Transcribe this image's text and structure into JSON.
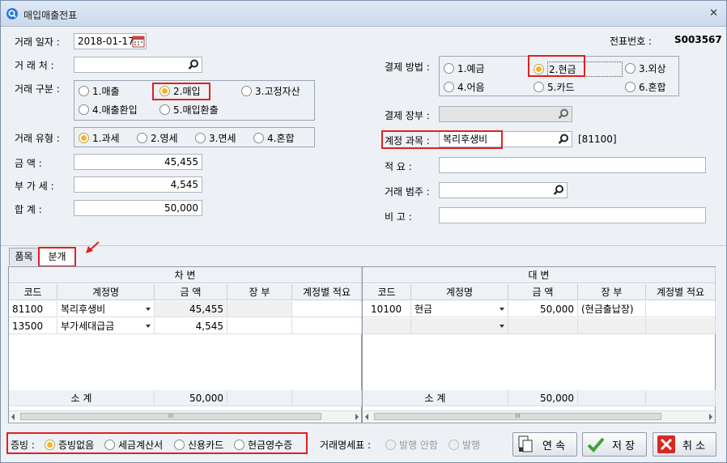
{
  "window": {
    "title": "매입매출전표",
    "close": "✕"
  },
  "header": {
    "date_label": "거래 일자 :",
    "date_value": "2018-01-17",
    "voucher_label": "전표번호 :",
    "voucher_value": "S003567",
    "partner_label": "거 래 처 :",
    "partner_value": "",
    "type_label": "거래 구분 :",
    "type_options": [
      "1.매출",
      "2.매입",
      "3.고정자산",
      "4.매출환입",
      "5.매입환출"
    ],
    "type_selected": "2.매입",
    "kind_label": "거래 유형 :",
    "kind_options": [
      "1.과세",
      "2.영세",
      "3.면세",
      "4.혼합"
    ],
    "kind_selected": "1.과세",
    "amount_label": "금     액 :",
    "amount_value": "45,455",
    "vat_label": "부 가 세 :",
    "vat_value": "4,545",
    "total_label": "합     계 :",
    "total_value": "50,000"
  },
  "payment": {
    "method_label": "결제 방법 :",
    "method_options": [
      "1.예금",
      "2.현금",
      "3.외상",
      "4.어음",
      "5.카드",
      "6.혼합"
    ],
    "method_selected": "2.현금",
    "ledger_label": "결제 장부 :",
    "ledger_value": "",
    "account_label": "계정 과목 :",
    "account_value": "복리후생비",
    "account_code": "[81100]",
    "memo_label": "적     요 :",
    "memo_value": "",
    "category_label": "거래 범주 :",
    "category_value": "",
    "note_label": "비     고 :",
    "note_value": ""
  },
  "tabs": [
    "품목",
    "분개"
  ],
  "active_tab": "분개",
  "debit": {
    "title": "차    변",
    "columns": [
      "코드",
      "계정명",
      "금  액",
      "장 부",
      "계정별 적요"
    ],
    "rows": [
      {
        "code": "81100",
        "name": "복리후생비",
        "amount": "45,455",
        "book": "",
        "memo": ""
      },
      {
        "code": "13500",
        "name": "부가세대급금",
        "amount": "4,545",
        "book": "",
        "memo": ""
      }
    ],
    "subtotal_label": "소    계",
    "subtotal_value": "50,000"
  },
  "credit": {
    "title": "대    변",
    "columns": [
      "코드",
      "계정명",
      "금  액",
      "장 부",
      "계정별 적요"
    ],
    "rows": [
      {
        "code": "10100",
        "name": "현금",
        "amount": "50,000",
        "book": "(현금출납장)",
        "memo": ""
      }
    ],
    "subtotal_label": "소    계",
    "subtotal_value": "50,000"
  },
  "footer": {
    "proof_label": "증빙 :",
    "proof_options": [
      "증빙없음",
      "세금계산서",
      "신용카드",
      "현금영수증"
    ],
    "proof_selected": "증빙없음",
    "statement_label": "거래명세표 :",
    "statement_options": [
      "발행 안함",
      "발행"
    ],
    "continue_label": "연 속",
    "save_label": "저 장",
    "cancel_label": "취 소"
  },
  "scroll_thumb": "III",
  "colors": {
    "highlight": "#e0201e",
    "radio_on": "#f3b32c",
    "title_bar": "#cbd9ea"
  }
}
